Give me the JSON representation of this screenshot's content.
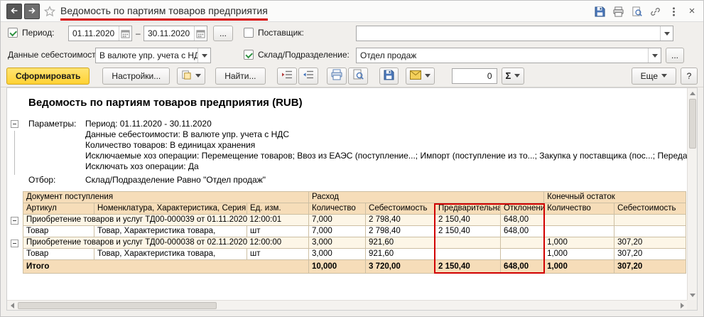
{
  "window": {
    "title": "Ведомость по партиям товаров предприятия",
    "close": "×"
  },
  "filters": {
    "period": {
      "label": "Период:",
      "checked": true,
      "from": "01.11.2020",
      "to": "30.11.2020",
      "dash": "–",
      "more": "..."
    },
    "supplier": {
      "label": "Поставщик:",
      "checked": false,
      "value": ""
    },
    "cost_data": {
      "label": "Данные себестоимости:",
      "value": "В валюте упр. учета с НДС"
    },
    "warehouse": {
      "label": "Склад/Подразделение:",
      "checked": true,
      "value": "Отдел продаж",
      "more": "..."
    }
  },
  "toolbar": {
    "generate": "Сформировать",
    "settings": "Настройки...",
    "find": "Найти...",
    "counter": "0",
    "sigma": "Σ",
    "more": "Еще",
    "help": "?"
  },
  "report": {
    "title": "Ведомость по партиям товаров предприятия (RUB)",
    "params_label": "Параметры:",
    "param_lines": [
      "Период: 01.11.2020 - 30.11.2020",
      "Данные себестоимости: В валюте упр. учета с НДС",
      "Количество товаров: В единицах хранения",
      "Исключаемые хоз операции: Перемещение товаров; Ввоз из ЕАЭС (поступление...; Импорт (поступление из то...; Закупка у поставщика (пос...; Передача продукции",
      "Исключать хоз операции: Да"
    ],
    "filter_label": "Отбор:",
    "filter_value": "Склад/Подразделение Равно \"Отдел продаж\""
  },
  "table": {
    "groups": [
      {
        "label": "Документ поступления",
        "span": 3
      },
      {
        "label": "Расход",
        "span": 4
      },
      {
        "label": "Конечный остаток",
        "span": 2
      }
    ],
    "columns": [
      "Артикул",
      "Номенклатура, Характеристика, Серия",
      "Ед. изм.",
      "Количество",
      "Себестоимость",
      "Предварительная",
      "Отклонение",
      "Количество",
      "Себестоимость"
    ],
    "rows": [
      {
        "type": "group",
        "cells": [
          "Приобретение товаров и услуг ТД00-000039 от 01.11.2020 12:00:01",
          "",
          "",
          "7,000",
          "2 798,40",
          "2 150,40",
          "648,00",
          "",
          ""
        ]
      },
      {
        "type": "item",
        "cells": [
          "Товар",
          "Товар, Характеристика товара,",
          "шт",
          "7,000",
          "2 798,40",
          "2 150,40",
          "648,00",
          "",
          ""
        ]
      },
      {
        "type": "group",
        "cells": [
          "Приобретение товаров и услуг ТД00-000038 от 02.11.2020 12:00:00",
          "",
          "",
          "3,000",
          "921,60",
          "",
          "",
          "1,000",
          "307,20"
        ]
      },
      {
        "type": "item",
        "cells": [
          "Товар",
          "Товар, Характеристика товара,",
          "шт",
          "3,000",
          "921,60",
          "",
          "",
          "1,000",
          "307,20"
        ]
      },
      {
        "type": "total",
        "cells": [
          "Итого",
          "",
          "",
          "10,000",
          "3 720,00",
          "2 150,40",
          "648,00",
          "1,000",
          "307,20"
        ]
      }
    ]
  },
  "colors": {
    "annotation_red": "#d10000",
    "table_header_bg": "#f6ddb9",
    "generate_button_yellow": "#ffd234"
  }
}
